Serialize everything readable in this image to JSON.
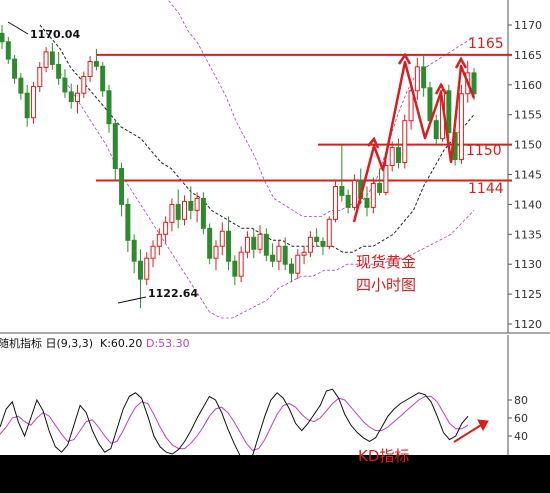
{
  "chart_data": {
    "type": "candlestick",
    "price_axis": {
      "ticks": [
        1170,
        1165,
        1160,
        1155,
        1150,
        1145,
        1140,
        1135,
        1130,
        1125,
        1120
      ],
      "ylim": [
        1119,
        1174
      ]
    },
    "candles": [
      [
        1168.6,
        1170.0,
        1166.0,
        1167.2
      ],
      [
        1167.2,
        1168.0,
        1163.5,
        1164.3
      ],
      [
        1164.3,
        1165.0,
        1160.2,
        1161.1
      ],
      [
        1161.1,
        1162.0,
        1157.5,
        1158.6
      ],
      [
        1158.6,
        1160.0,
        1153.0,
        1154.5
      ],
      [
        1154.5,
        1160.5,
        1153.5,
        1159.7
      ],
      [
        1159.7,
        1163.8,
        1158.8,
        1162.9
      ],
      [
        1162.9,
        1166.3,
        1162.1,
        1165.5
      ],
      [
        1165.5,
        1167.0,
        1162.5,
        1163.4
      ],
      [
        1163.4,
        1165.5,
        1160.0,
        1161.1
      ],
      [
        1161.1,
        1162.6,
        1157.8,
        1158.8
      ],
      [
        1158.8,
        1160.2,
        1156.0,
        1157.2
      ],
      [
        1157.2,
        1160.0,
        1155.2,
        1158.6
      ],
      [
        1158.6,
        1162.2,
        1157.8,
        1161.4
      ],
      [
        1161.4,
        1164.8,
        1160.5,
        1163.9
      ],
      [
        1163.9,
        1166.0,
        1162.4,
        1163.1
      ],
      [
        1163.1,
        1163.8,
        1158.0,
        1159.0
      ],
      [
        1159.0,
        1160.0,
        1152.0,
        1153.5
      ],
      [
        1153.5,
        1154.2,
        1144.0,
        1146.0
      ],
      [
        1146.0,
        1147.0,
        1138.0,
        1140.0
      ],
      [
        1140.0,
        1141.0,
        1132.0,
        1134.0
      ],
      [
        1134.0,
        1135.0,
        1128.5,
        1130.5
      ],
      [
        1130.5,
        1132.5,
        1122.64,
        1127.5
      ],
      [
        1127.5,
        1132.0,
        1126.5,
        1131.0
      ],
      [
        1131.0,
        1134.0,
        1129.5,
        1133.0
      ],
      [
        1133.0,
        1136.0,
        1131.5,
        1135.0
      ],
      [
        1135.0,
        1138.0,
        1133.5,
        1137.0
      ],
      [
        1137.0,
        1141.0,
        1135.5,
        1140.0
      ],
      [
        1140.0,
        1142.5,
        1136.0,
        1137.5
      ],
      [
        1137.5,
        1141.5,
        1136.5,
        1140.5
      ],
      [
        1140.5,
        1143.0,
        1137.5,
        1139.0
      ],
      [
        1139.0,
        1142.0,
        1137.0,
        1141.0
      ],
      [
        1141.0,
        1142.0,
        1135.0,
        1136.0
      ],
      [
        1136.0,
        1136.8,
        1130.0,
        1131.0
      ],
      [
        1131.0,
        1134.0,
        1129.0,
        1133.0
      ],
      [
        1133.0,
        1137.0,
        1131.5,
        1135.5
      ],
      [
        1135.5,
        1138.0,
        1129.0,
        1130.5
      ],
      [
        1130.5,
        1131.5,
        1126.5,
        1128.0
      ],
      [
        1128.0,
        1133.0,
        1127.0,
        1132.0
      ],
      [
        1132.0,
        1135.5,
        1131.0,
        1134.5
      ],
      [
        1134.5,
        1136.0,
        1131.0,
        1132.5
      ],
      [
        1132.5,
        1136.5,
        1131.8,
        1135.0
      ],
      [
        1135.0,
        1136.0,
        1130.5,
        1131.5
      ],
      [
        1131.5,
        1133.5,
        1129.5,
        1130.5
      ],
      [
        1130.5,
        1134.0,
        1129.0,
        1133.0
      ],
      [
        1133.0,
        1134.5,
        1129.0,
        1130.0
      ],
      [
        1130.0,
        1131.0,
        1127.0,
        1128.5
      ],
      [
        1128.5,
        1132.5,
        1127.5,
        1131.5
      ],
      [
        1131.5,
        1133.0,
        1130.0,
        1132.0
      ],
      [
        1132.0,
        1135.5,
        1131.2,
        1134.5
      ],
      [
        1134.5,
        1136.0,
        1133.0,
        1133.8
      ],
      [
        1133.8,
        1134.5,
        1131.5,
        1133.0
      ],
      [
        1133.0,
        1138.0,
        1132.5,
        1137.5
      ],
      [
        1137.5,
        1144.0,
        1137.0,
        1143.0
      ],
      [
        1143.0,
        1150.0,
        1140.5,
        1141.5
      ],
      [
        1141.5,
        1142.5,
        1138.5,
        1139.5
      ],
      [
        1139.5,
        1145.0,
        1139.0,
        1144.0
      ],
      [
        1144.0,
        1146.0,
        1140.0,
        1141.0
      ],
      [
        1141.0,
        1143.0,
        1138.0,
        1139.5
      ],
      [
        1139.5,
        1144.5,
        1138.5,
        1143.5
      ],
      [
        1143.5,
        1146.0,
        1141.5,
        1142.0
      ],
      [
        1142.0,
        1147.5,
        1141.5,
        1146.5
      ],
      [
        1146.5,
        1150.5,
        1145.5,
        1149.5
      ],
      [
        1149.5,
        1151.0,
        1146.0,
        1147.0
      ],
      [
        1147.0,
        1155.0,
        1146.0,
        1154.0
      ],
      [
        1154.0,
        1160.0,
        1152.5,
        1159.0
      ],
      [
        1159.0,
        1164.5,
        1157.5,
        1163.0
      ],
      [
        1163.0,
        1165.0,
        1158.0,
        1159.5
      ],
      [
        1159.5,
        1160.5,
        1153.0,
        1154.0
      ],
      [
        1154.0,
        1155.0,
        1150.0,
        1151.0
      ],
      [
        1151.0,
        1160.0,
        1150.5,
        1159.0
      ],
      [
        1159.0,
        1160.0,
        1151.0,
        1152.0
      ],
      [
        1152.0,
        1152.5,
        1146.5,
        1147.5
      ],
      [
        1147.5,
        1160.0,
        1146.8,
        1158.5
      ],
      [
        1158.5,
        1164.0,
        1157.0,
        1162.0
      ],
      [
        1162.0,
        1162.8,
        1157.5,
        1158.5
      ]
    ],
    "ma_line": [
      1170,
      1168,
      1166,
      1163,
      1161,
      1159,
      1157,
      1155,
      1153,
      1152,
      1151,
      1149,
      1147,
      1146,
      1144,
      1142,
      1141,
      1139,
      1138,
      1137,
      1136,
      1136,
      1135,
      1134,
      1134,
      1133,
      1133,
      1133,
      1133,
      1133,
      1132,
      1132,
      1133,
      1133,
      1134,
      1135,
      1137,
      1139,
      1143,
      1146,
      1149,
      1151,
      1153,
      1155
    ],
    "upper_band": [
      1178,
      1176,
      1174,
      1172,
      1169,
      1167,
      1164,
      1161,
      1158,
      1154,
      1151,
      1148,
      1144,
      1141,
      1140,
      1139,
      1138,
      1138,
      1138,
      1139,
      1139,
      1140,
      1140,
      1142,
      1145,
      1150,
      1155,
      1159,
      1162,
      1163,
      1164,
      1165,
      1166,
      1167,
      1168
    ],
    "lower_band": [
      1162,
      1159,
      1156,
      1153,
      1150,
      1146,
      1143,
      1140,
      1137,
      1134,
      1131,
      1128,
      1125,
      1122,
      1121,
      1121,
      1122,
      1123,
      1124,
      1126,
      1127,
      1128,
      1128,
      1129,
      1129,
      1130,
      1130,
      1130,
      1130,
      1131,
      1131,
      1132,
      1133,
      1134,
      1135,
      1137,
      1139
    ],
    "levels": [
      {
        "value": 1165,
        "label": "1165"
      },
      {
        "value": 1150,
        "label": "1150"
      },
      {
        "value": 1144,
        "label": "1144"
      }
    ],
    "highlow_labels": {
      "high": "1170.04",
      "low": "1122.64"
    },
    "kd": {
      "title_text": "随机指标 日(9,3,3)",
      "k_label": "K:60.20",
      "d_label": "D:53.30",
      "k_value": 60.2,
      "d_value": 53.3,
      "axis_ticks": [
        80,
        60,
        40
      ],
      "ylim": [
        10,
        92
      ],
      "k": [
        50,
        70,
        78,
        55,
        40,
        60,
        80,
        68,
        45,
        28,
        22,
        30,
        52,
        74,
        66,
        46,
        32,
        22,
        26,
        48,
        70,
        84,
        88,
        82,
        62,
        40,
        28,
        22,
        20,
        25,
        34,
        46,
        60,
        72,
        84,
        80,
        66,
        48,
        32,
        18,
        12,
        18,
        40,
        62,
        80,
        88,
        82,
        70,
        54,
        46,
        54,
        64,
        74,
        90,
        92,
        82,
        64,
        52,
        44,
        38,
        34,
        38,
        50,
        62,
        70,
        76,
        80,
        84,
        88,
        86,
        78,
        62,
        44,
        36,
        40,
        54,
        62
      ],
      "d": [
        42,
        50,
        60,
        62,
        56,
        52,
        60,
        66,
        62,
        52,
        42,
        34,
        36,
        46,
        56,
        58,
        50,
        40,
        32,
        34,
        46,
        60,
        72,
        78,
        76,
        64,
        50,
        38,
        30,
        26,
        26,
        32,
        40,
        50,
        62,
        70,
        72,
        66,
        56,
        44,
        32,
        24,
        26,
        36,
        50,
        64,
        74,
        76,
        72,
        64,
        58,
        56,
        60,
        68,
        76,
        82,
        80,
        72,
        64,
        56,
        50,
        46,
        46,
        50,
        56,
        62,
        68,
        74,
        80,
        84,
        84,
        78,
        66,
        54,
        48,
        48,
        52
      ]
    }
  },
  "annotations": {
    "title_line1": "现货黄金",
    "title_line2": "四小时图",
    "kd_caption": "KD指标"
  },
  "colors": {
    "up": "#e02020",
    "down": "#2f8a2f",
    "ma": "#222222",
    "band": "#b040c0",
    "level": "#d81e1e",
    "k_line": "#111111",
    "d_line": "#c040c0"
  }
}
